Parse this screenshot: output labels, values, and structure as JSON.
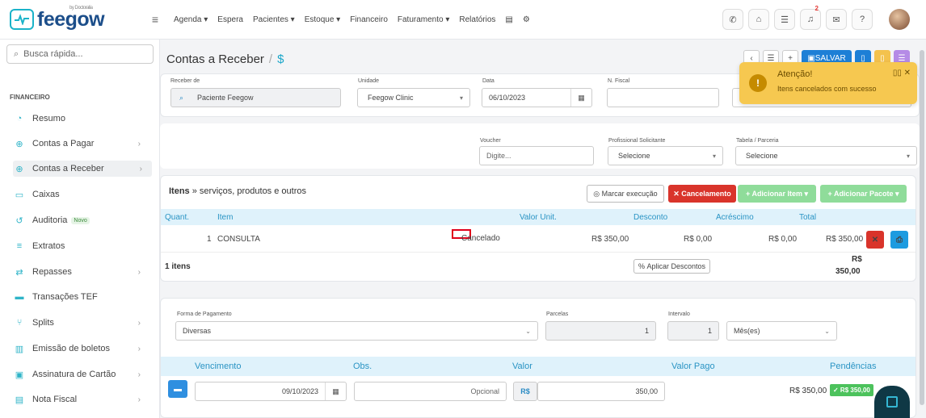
{
  "brand": {
    "name": "feegow",
    "tagline": "by Doctoralia"
  },
  "topnav": [
    "Agenda ▾",
    "Espera",
    "Pacientes ▾",
    "Estoque ▾",
    "Financeiro",
    "Faturamento ▾",
    "Relatórios"
  ],
  "notifications_count": "2",
  "sidebar": {
    "search_placeholder": "Busca rápida...",
    "section": "FINANCEIRO",
    "items": [
      {
        "label": "Resumo",
        "icon": "◔"
      },
      {
        "label": "Contas a Pagar",
        "icon": "⊕"
      },
      {
        "label": "Contas a Receber",
        "icon": "⊕"
      },
      {
        "label": "Caixas",
        "icon": "▭"
      },
      {
        "label": "Auditoria",
        "icon": "↺",
        "badge": "Novo"
      },
      {
        "label": "Extratos",
        "icon": "≡"
      },
      {
        "label": "Repasses",
        "icon": "⇄"
      },
      {
        "label": "Transações TEF",
        "icon": "▬"
      },
      {
        "label": "Splits",
        "icon": "⑂"
      },
      {
        "label": "Emissão de boletos",
        "icon": "▥"
      },
      {
        "label": "Assinatura de Cartão",
        "icon": "▣"
      },
      {
        "label": "Nota Fiscal",
        "icon": "▤"
      }
    ]
  },
  "page": {
    "title": "Contas a Receber",
    "currency_symbol": "$",
    "save_label": "SALVAR"
  },
  "form": {
    "receber_de_label": "Receber de",
    "receber_de_value": "Paciente Feegow",
    "unidade_label": "Unidade",
    "unidade_value": "Feegow Clinic",
    "data_label": "Data",
    "data_value": "06/10/2023",
    "nfiscal_label": "N. Fiscal",
    "voucher_label": "Voucher",
    "voucher_placeholder": "Digite...",
    "prof_label": "Profissional Solicitante",
    "prof_value": "Selecione",
    "tabela_label": "Tabela / Parceria",
    "tabela_value": "Selecione"
  },
  "items": {
    "title": "Itens",
    "subtitle": "» serviços, produtos e outros",
    "btn_marcar": "Marcar execução",
    "btn_cancel": "Cancelamento",
    "btn_add_item": "+ Adicionar Item ▾",
    "btn_add_pacote": "+ Adicionar Pacote ▾",
    "headers": [
      "Quant.",
      "Item",
      "Valor Unit.",
      "Desconto",
      "Acréscimo",
      "Total"
    ],
    "row": {
      "qty": "1",
      "item": "CONSULTA",
      "status": "Cancelado",
      "valor": "R$ 350,00",
      "desconto": "R$ 0,00",
      "acrescimo": "R$ 0,00",
      "total": "R$ 350,00"
    },
    "count": "1 itens",
    "btn_descontos": "Aplicar Descontos",
    "total_currency": "R$",
    "total_value": "350,00"
  },
  "payment": {
    "forma_label": "Forma de Pagamento",
    "forma_value": "Diversas",
    "parcelas_label": "Parcelas",
    "parcelas_value": "1",
    "intervalo_label": "Intervalo",
    "intervalo_value": "1",
    "periodo_value": "Mês(es)",
    "headers": [
      "Vencimento",
      "Obs.",
      "Valor",
      "Valor Pago",
      "Pendências"
    ],
    "row": {
      "vencimento": "09/10/2023",
      "obs_placeholder": "Opcional",
      "currency": "R$",
      "valor": "350,00",
      "pago": "R$ 350,00",
      "pendencia": "✓ R$ 350,00"
    }
  },
  "toast": {
    "title": "Atenção!",
    "message": "Itens cancelados com sucesso",
    "color": "#f6c850"
  }
}
